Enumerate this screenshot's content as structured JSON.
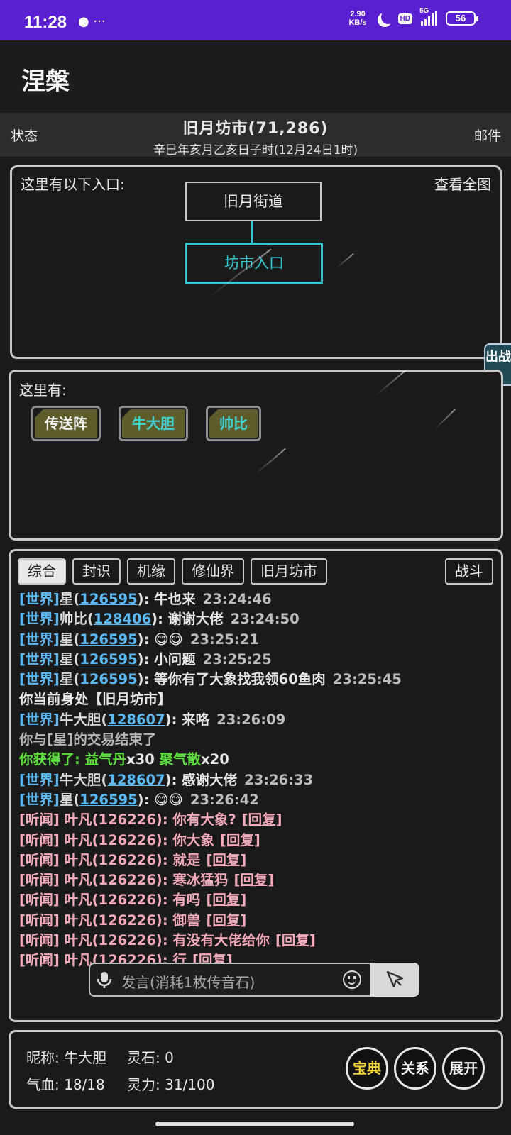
{
  "statusbar": {
    "time": "11:28",
    "left_icons": "● ···",
    "speed_top": "2.90",
    "speed_bottom": "KB/s",
    "hd": "HD",
    "net": "5G",
    "battery": "56"
  },
  "app": {
    "title": "涅槃"
  },
  "location_bar": {
    "left": "状态",
    "right": "邮件",
    "location": "旧月坊市(71,286)",
    "date": "辛巳年亥月乙亥日子时(12月24日1时)"
  },
  "entrances": {
    "label": "这里有以下入口:",
    "view_all": "查看全图",
    "node_top": "旧月街道",
    "node_current": "坊市入口"
  },
  "side_tab": {
    "label": "出战"
  },
  "here": {
    "label": "这里有:",
    "npcs": [
      "传送阵",
      "牛大胆",
      "帅比"
    ]
  },
  "chat": {
    "tabs": [
      "综合",
      "封识",
      "机缘",
      "修仙界",
      "旧月坊市"
    ],
    "battle_tab": "战斗",
    "messages": [
      {
        "ch": "[世界]",
        "name": "星(",
        "uid": "126595",
        "text": "): 牛也来",
        "time": "23:24:46"
      },
      {
        "ch": "[世界]",
        "name": "帅比(",
        "uid": "128406",
        "text": "): 谢谢大佬",
        "time": "23:24:50"
      },
      {
        "ch": "[世界]",
        "name": "星(",
        "uid": "126595",
        "text": "): 😋😋",
        "time": "23:25:21"
      },
      {
        "ch": "[世界]",
        "name": "星(",
        "uid": "126595",
        "text": "): 小问题",
        "time": "23:25:25"
      },
      {
        "ch": "[世界]",
        "name": "星(",
        "uid": "126595",
        "text": "): 等你有了大象找我领60鱼肉",
        "time": "23:25:45"
      },
      {
        "sys": "你当前身处【旧月坊市】"
      },
      {
        "ch": "[世界]",
        "name": "牛大胆(",
        "uid": "128607",
        "text": "): 来咯",
        "time": "23:26:09"
      },
      {
        "gray": "你与[星]的交易结束了"
      },
      {
        "gain_prefix": "你获得了: 益气丹",
        "gain_qty1": "x30",
        "gain_item2": " 聚气散",
        "gain_qty2": "x20"
      },
      {
        "ch": "[世界]",
        "name": "牛大胆(",
        "uid": "128607",
        "text": "): 感谢大佬",
        "time": "23:26:33"
      },
      {
        "ch": "[世界]",
        "name": "星(",
        "uid": "126595",
        "text": "): 😋😋",
        "time": "23:26:42"
      },
      {
        "pm": "[听闻] 叶凡(126226): 你有大象?",
        "reply": "[回复]"
      },
      {
        "pm": "[听闻] 叶凡(126226): 你大象",
        "reply": "[回复]"
      },
      {
        "pm": "[听闻] 叶凡(126226): 就是",
        "reply": "[回复]"
      },
      {
        "pm": "[听闻] 叶凡(126226): 寒冰猛犸",
        "reply": "[回复]"
      },
      {
        "pm": "[听闻] 叶凡(126226): 有吗",
        "reply": "[回复]"
      },
      {
        "pm": "[听闻] 叶凡(126226): 御兽",
        "reply": "[回复]"
      },
      {
        "pm": "[听闻] 叶凡(126226): 有没有大佬给你",
        "reply": "[回复]"
      },
      {
        "pm": "[听闻] 叶凡(126226): 行",
        "reply": "[回复]"
      }
    ],
    "input_placeholder": "发言(消耗1枚传音石)"
  },
  "player": {
    "nickname": "昵称: 牛大胆",
    "spirit_stone": "灵石: 0",
    "hp": "气血: 18/18",
    "mana": "灵力: 31/100",
    "btn_codex": "宝典",
    "btn_relations": "关系",
    "btn_expand": "展开"
  },
  "colors": {
    "statusbar": "#5a1fd0",
    "accent_cyan": "#36c6cf",
    "channel_blue": "#5cb8f2",
    "gain_green": "#5de03f",
    "pm_pink": "#f2a9b9",
    "gold": "#f2d33a"
  }
}
